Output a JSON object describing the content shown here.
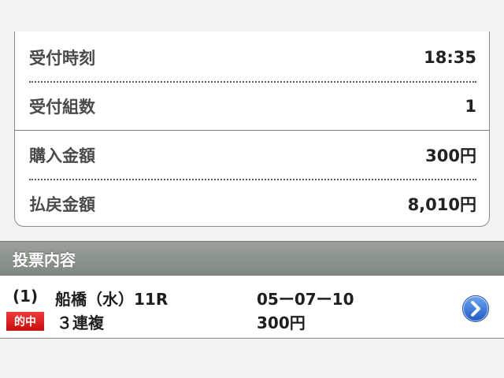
{
  "summary": {
    "rows": [
      {
        "label": "受付時刻",
        "value": "18:35"
      },
      {
        "label": "受付組数",
        "value": "1"
      },
      {
        "label": "購入金額",
        "value": "300円"
      },
      {
        "label": "払戻金額",
        "value": "8,010円"
      }
    ]
  },
  "section": {
    "title": "投票内容"
  },
  "bet": {
    "number": "(1)",
    "race": "船橋（水）11R",
    "combination": "05ー07ー10",
    "hit_badge": "的中",
    "bet_type": "３連複",
    "amount": "300円",
    "detail_icon": "chevron-right-icon"
  },
  "colors": {
    "header_bg": "#8a928b",
    "hit_badge": "#e02020",
    "chevron_blue": "#2f6fd6"
  }
}
